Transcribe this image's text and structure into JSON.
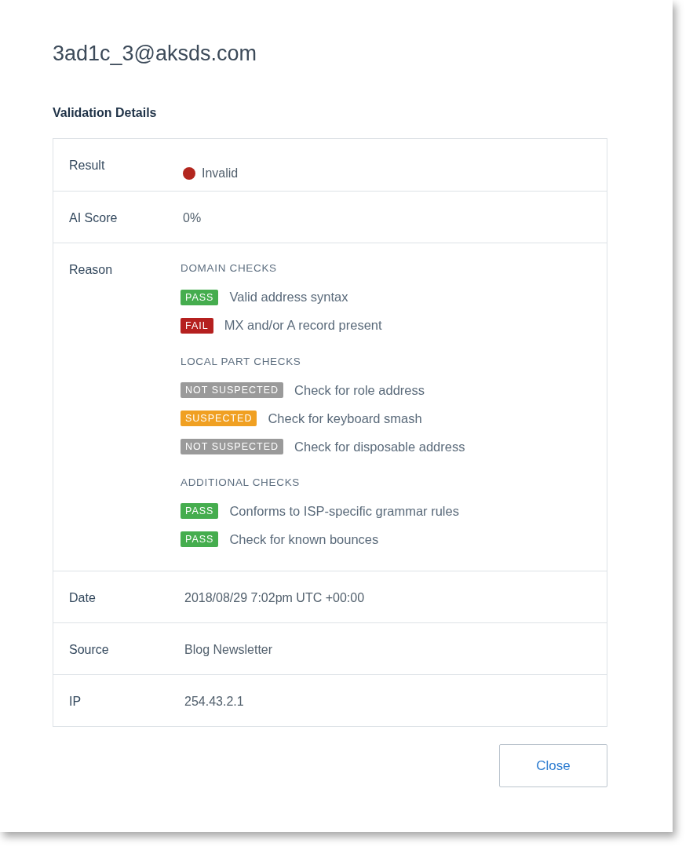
{
  "title": "3ad1c_3@aksds.com",
  "section_title": "Validation Details",
  "result": {
    "label": "Result",
    "value": "Invalid",
    "color": "#b3261e"
  },
  "ai_score": {
    "label": "AI Score",
    "value": "0%"
  },
  "reason": {
    "label": "Reason",
    "groups": [
      {
        "heading": "DOMAIN CHECKS",
        "checks": [
          {
            "kind": "pass",
            "badge": "PASS",
            "text": "Valid address syntax"
          },
          {
            "kind": "fail",
            "badge": "FAIL",
            "text": "MX and/or A record present"
          }
        ]
      },
      {
        "heading": "LOCAL PART CHECKS",
        "checks": [
          {
            "kind": "neutral",
            "badge": "NOT SUSPECTED",
            "text": "Check for role address"
          },
          {
            "kind": "warning",
            "badge": "SUSPECTED",
            "text": "Check for keyboard smash"
          },
          {
            "kind": "neutral",
            "badge": "NOT SUSPECTED",
            "text": "Check for disposable address"
          }
        ]
      },
      {
        "heading": "ADDITIONAL CHECKS",
        "checks": [
          {
            "kind": "pass",
            "badge": "PASS",
            "text": "Conforms to ISP-specific grammar rules"
          },
          {
            "kind": "pass",
            "badge": "PASS",
            "text": "Check for known bounces"
          }
        ]
      }
    ]
  },
  "details": [
    {
      "label": "Date",
      "value": "2018/08/29 7:02pm UTC +00:00"
    },
    {
      "label": "Source",
      "value": "Blog Newsletter"
    },
    {
      "label": "IP",
      "value": "254.43.2.1"
    }
  ],
  "close_button": "Close"
}
